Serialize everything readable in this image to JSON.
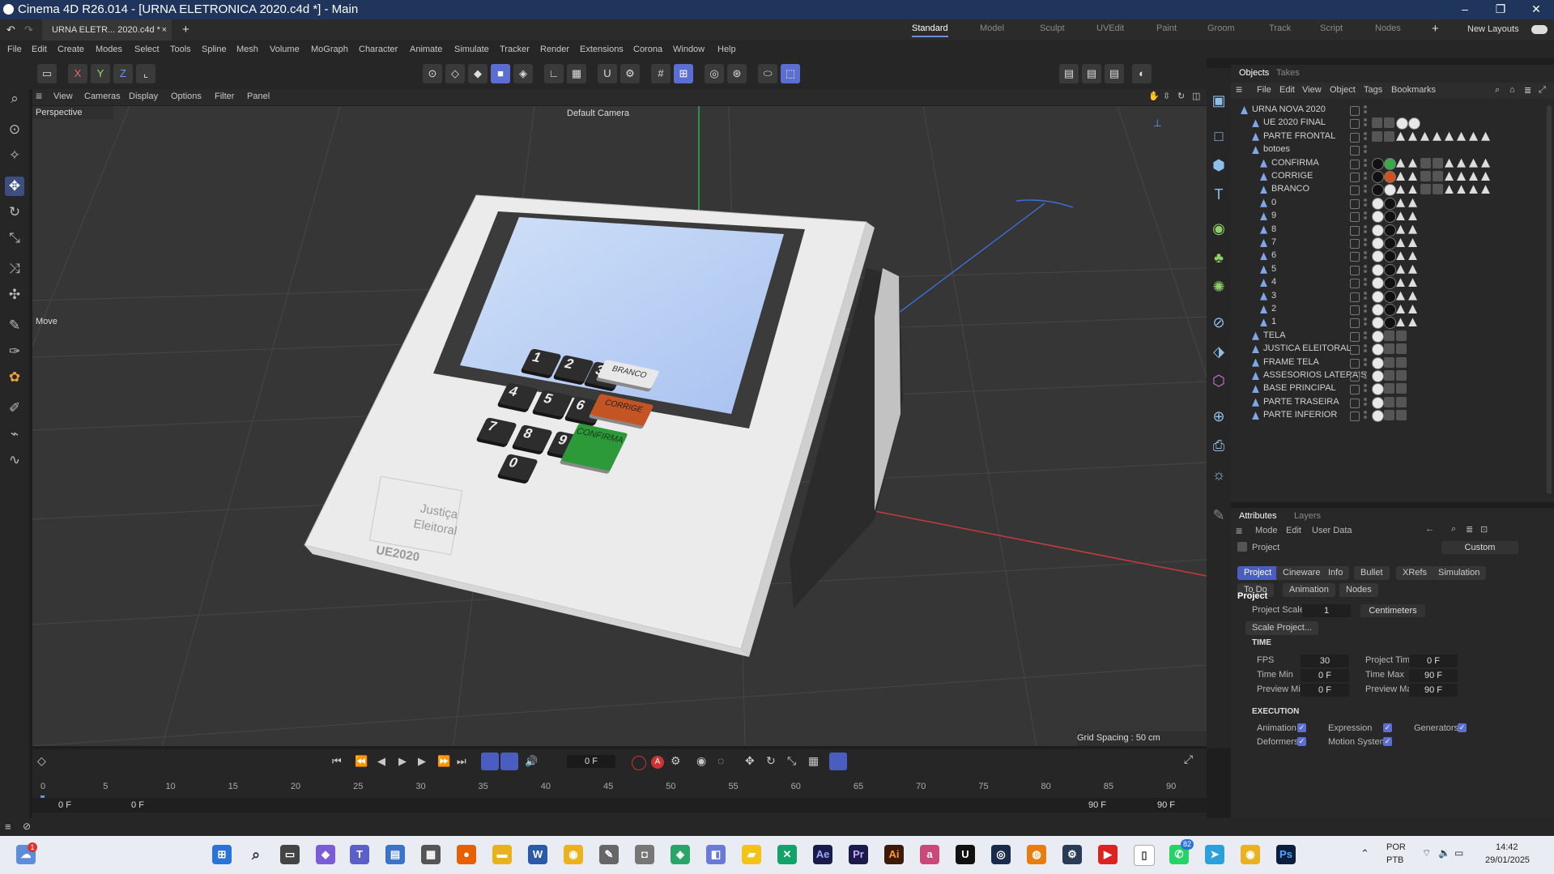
{
  "window": {
    "title": "Cinema 4D R26.014 - [URNA ELETRONICA 2020.c4d *] - Main",
    "min": "–",
    "max": "❐",
    "close": "✕"
  },
  "tabs": {
    "file_tab": "URNA ELETR... 2020.c4d *",
    "close": "×",
    "add": "+"
  },
  "layouts": [
    "Standard",
    "Model",
    "Sculpt",
    "UVEdit",
    "Paint",
    "Groom",
    "Track",
    "Script",
    "Nodes"
  ],
  "new_layouts": "New Layouts",
  "menu": [
    "File",
    "Edit",
    "Create",
    "Modes",
    "Select",
    "Tools",
    "Spline",
    "Mesh",
    "Volume",
    "MoGraph",
    "Character",
    "Animate",
    "Simulate",
    "Tracker",
    "Render",
    "Extensions",
    "Corona",
    "Window",
    "Help"
  ],
  "axes": {
    "x": "X",
    "y": "Y",
    "z": "Z"
  },
  "viewport": {
    "menu": [
      "View",
      "Cameras",
      "Display",
      "Options",
      "Filter",
      "Panel"
    ],
    "label": "Perspective",
    "camera": "Default Camera",
    "move_label": "Move",
    "grid_spacing": "Grid Spacing : 50 cm"
  },
  "model": {
    "brand1": "Justiça",
    "brand2": "Eleitoral",
    "model_name": "UE2020",
    "keys": [
      "1",
      "2",
      "3",
      "4",
      "5",
      "6",
      "7",
      "8",
      "9",
      "0"
    ],
    "branco": "BRANCO",
    "corrige": "CORRIGE",
    "confirma": "CONFIRMA"
  },
  "objects_panel": {
    "tabs": [
      "Objects",
      "Takes"
    ],
    "menu": [
      "File",
      "Edit",
      "View",
      "Object",
      "Tags",
      "Bookmarks"
    ],
    "items": [
      {
        "name": "URNA NOVA 2020"
      },
      {
        "name": "UE 2020 FINAL"
      },
      {
        "name": "PARTE FRONTAL"
      },
      {
        "name": "botoes"
      },
      {
        "name": "CONFIRMA"
      },
      {
        "name": "CORRIGE"
      },
      {
        "name": "BRANCO"
      },
      {
        "name": "0"
      },
      {
        "name": "9"
      },
      {
        "name": "8"
      },
      {
        "name": "7"
      },
      {
        "name": "6"
      },
      {
        "name": "5"
      },
      {
        "name": "4"
      },
      {
        "name": "3"
      },
      {
        "name": "2"
      },
      {
        "name": "1"
      },
      {
        "name": "TELA"
      },
      {
        "name": "JUSTICA ELEITORAL"
      },
      {
        "name": "FRAME TELA"
      },
      {
        "name": "ASSESORIOS LATERAIS"
      },
      {
        "name": "BASE PRINCIPAL"
      },
      {
        "name": "PARTE TRASEIRA"
      },
      {
        "name": "PARTE INFERIOR"
      }
    ]
  },
  "attributes": {
    "tabs": [
      "Attributes",
      "Layers"
    ],
    "menu": [
      "Mode",
      "Edit",
      "User Data"
    ],
    "object_label": "Project",
    "preset": "Custom",
    "buttons_row1": [
      "Project",
      "Cineware",
      "Info",
      "Bullet",
      "XRefs",
      "Simulation"
    ],
    "buttons_row2": [
      "To Do",
      "Animation",
      "Nodes"
    ],
    "section": "Project",
    "project_scale_label": "Project Scale",
    "project_scale_value": "1",
    "unit": "Centimeters",
    "scale_button": "Scale Project...",
    "time_header": "TIME",
    "fps_label": "FPS",
    "fps": "30",
    "project_time_label": "Project Time",
    "project_time": "0 F",
    "time_min_label": "Time Min",
    "time_min": "0 F",
    "time_max_label": "Time Max",
    "time_max": "90 F",
    "preview_min_label": "Preview Min",
    "preview_min": "0 F",
    "preview_max_label": "Preview Max",
    "preview_max": "90 F",
    "exec_header": "EXECUTION",
    "exec": [
      "Animation",
      "Expression",
      "Generators",
      "Deformers",
      "Motion System"
    ]
  },
  "timeline": {
    "current_frame": "0 F",
    "ticks": [
      "0",
      "5",
      "10",
      "15",
      "20",
      "25",
      "30",
      "35",
      "40",
      "45",
      "50",
      "55",
      "60",
      "65",
      "70",
      "75",
      "80",
      "85",
      "90"
    ],
    "start": "0 F",
    "start2": "0 F",
    "end": "90 F",
    "end2": "90 F"
  },
  "taskbar": {
    "badge_weather": "1",
    "badge_whatsapp": "82",
    "lang1": "POR",
    "lang2": "PTB",
    "time": "14:42",
    "date": "29/01/2025"
  }
}
